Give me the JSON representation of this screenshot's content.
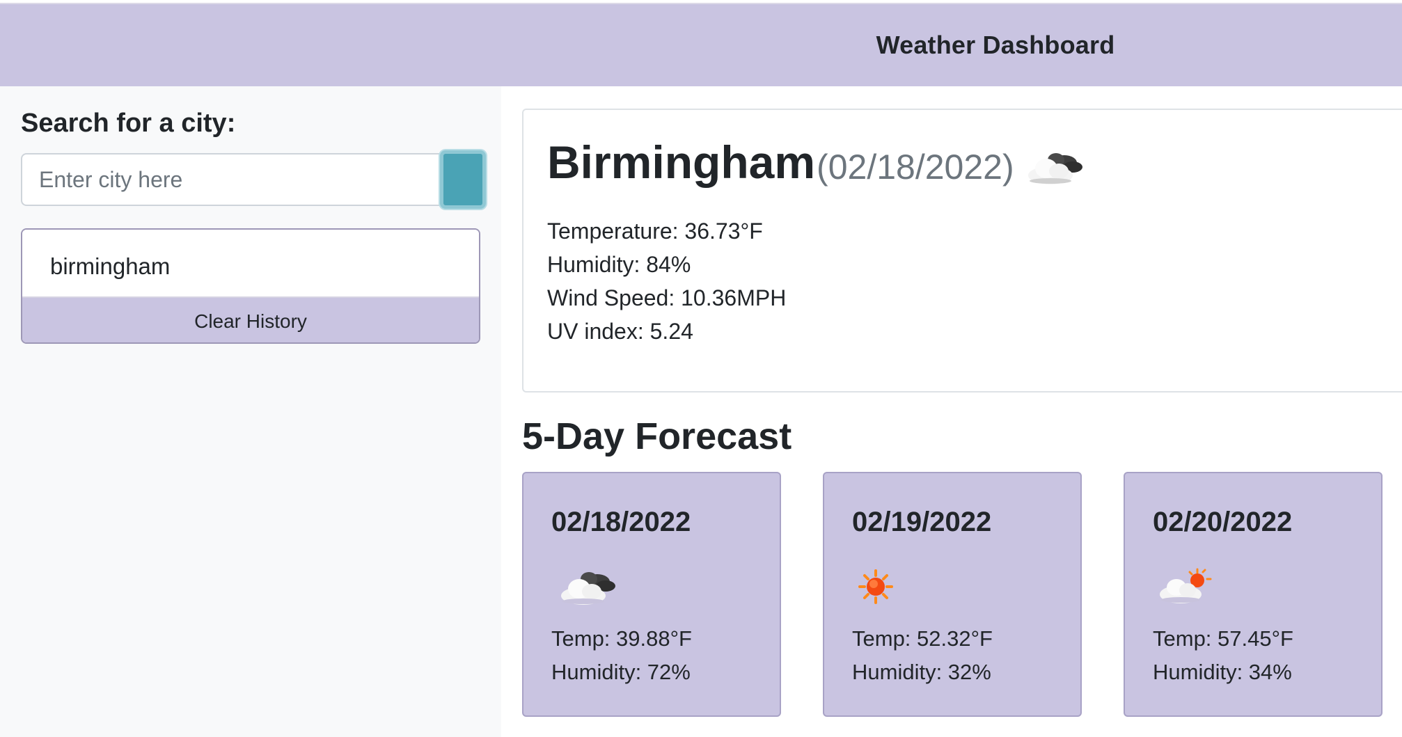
{
  "header": {
    "title": "Weather Dashboard"
  },
  "sidebar": {
    "search_label": "Search for a city:",
    "search_placeholder": "Enter city here",
    "search_value": "",
    "history": [
      {
        "label": "birmingham"
      }
    ],
    "clear_label": "Clear History"
  },
  "current": {
    "city": "Birmingham",
    "date": "(02/18/2022)",
    "icon": "cloudy-icon",
    "temperature": "Temperature: 36.73°F",
    "humidity": "Humidity: 84%",
    "wind": "Wind Speed: 10.36MPH",
    "uv": "UV index: 5.24"
  },
  "forecast": {
    "title": "5-Day Forecast",
    "days": [
      {
        "date": "02/18/2022",
        "icon": "cloudy-icon",
        "temp": "Temp: 39.88°F",
        "humidity": "Humidity: 72%"
      },
      {
        "date": "02/19/2022",
        "icon": "sun-icon",
        "temp": "Temp: 52.32°F",
        "humidity": "Humidity: 32%"
      },
      {
        "date": "02/20/2022",
        "icon": "partly-sunny-icon",
        "temp": "Temp: 57.45°F",
        "humidity": "Humidity: 34%"
      }
    ]
  },
  "colors": {
    "header": "#c9c4e1",
    "sidebar_bg": "#f8f9fa",
    "search_button": "#4aa3b5",
    "card_bg": "#c9c4e1"
  }
}
